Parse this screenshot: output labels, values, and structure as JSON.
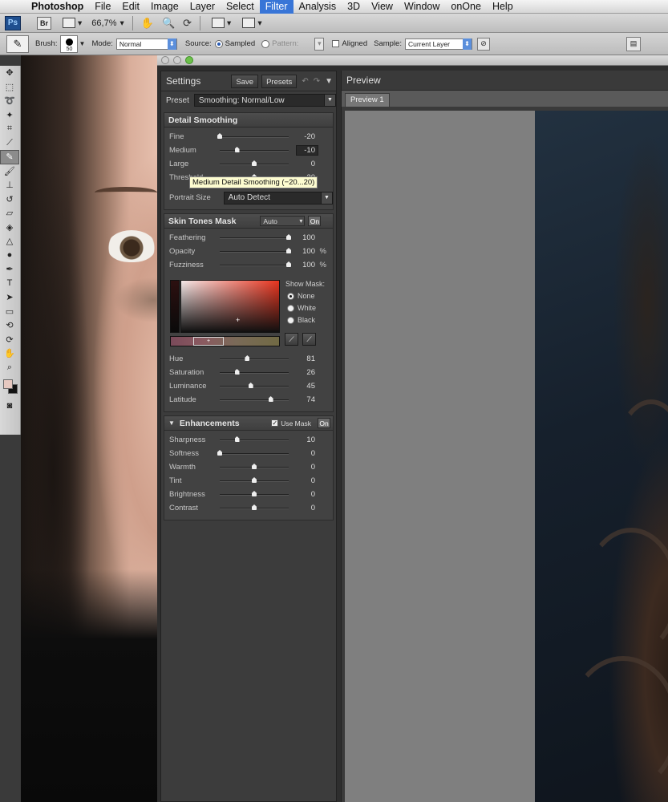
{
  "menubar": {
    "app": "Photoshop",
    "items": [
      "File",
      "Edit",
      "Image",
      "Layer",
      "Select",
      "Filter",
      "Analysis",
      "3D",
      "View",
      "Window",
      "onOne",
      "Help"
    ],
    "active": "Filter"
  },
  "appbar": {
    "ps_logo": "Ps",
    "br_logo": "Br",
    "zoom": "66,7%"
  },
  "options": {
    "brush_label": "Brush:",
    "brush_size": "50",
    "mode_label": "Mode:",
    "mode_value": "Normal",
    "source_label": "Source:",
    "sampled_label": "Sampled",
    "pattern_label": "Pattern:",
    "aligned_label": "Aligned",
    "sample_label": "Sample:",
    "sample_value": "Current Layer"
  },
  "settings": {
    "title": "Settings",
    "save_label": "Save",
    "presets_label": "Presets",
    "preset_label": "Preset",
    "preset_value": "Smoothing: Normal/Low",
    "tooltip": "Medium Detail Smoothing (−20...20)",
    "detail": {
      "title": "Detail Smoothing",
      "sliders": [
        {
          "label": "Fine",
          "value": "-20",
          "pos": 0.0
        },
        {
          "label": "Medium",
          "value": "-10",
          "pos": 0.25
        },
        {
          "label": "Large",
          "value": "0",
          "pos": 0.5
        },
        {
          "label": "Threshold",
          "value": "20",
          "pos": 0.5
        }
      ],
      "portrait_label": "Portrait Size",
      "portrait_value": "Auto Detect"
    },
    "skin": {
      "title": "Skin Tones Mask",
      "mode_value": "Auto",
      "on_label": "On",
      "sliders": [
        {
          "label": "Feathering",
          "value": "100",
          "unit": "",
          "pos": 1.0
        },
        {
          "label": "Opacity",
          "value": "100",
          "unit": "%",
          "pos": 1.0
        },
        {
          "label": "Fuzziness",
          "value": "100",
          "unit": "%",
          "pos": 1.0
        }
      ],
      "show_mask_label": "Show Mask:",
      "mask_options": [
        "None",
        "White",
        "Black"
      ],
      "mask_selected": "None",
      "hsl": [
        {
          "label": "Hue",
          "value": "81",
          "pos": 0.4
        },
        {
          "label": "Saturation",
          "value": "26",
          "pos": 0.25
        },
        {
          "label": "Luminance",
          "value": "45",
          "pos": 0.45
        },
        {
          "label": "Latitude",
          "value": "74",
          "pos": 0.74
        }
      ]
    },
    "enh": {
      "title": "Enhancements",
      "use_mask_label": "Use Mask",
      "on_label": "On",
      "sliders": [
        {
          "label": "Sharpness",
          "value": "10",
          "pos": 0.25
        },
        {
          "label": "Softness",
          "value": "0",
          "pos": 0.0
        },
        {
          "label": "Warmth",
          "value": "0",
          "pos": 0.5
        },
        {
          "label": "Tint",
          "value": "0",
          "pos": 0.5
        },
        {
          "label": "Brightness",
          "value": "0",
          "pos": 0.5
        },
        {
          "label": "Contrast",
          "value": "0",
          "pos": 0.5
        }
      ]
    }
  },
  "preview": {
    "title": "Preview",
    "tab": "Preview 1"
  },
  "colors": {
    "menu_active": "#3875d7",
    "panel_bg": "#3c3c3c",
    "fg_swatch": "#e6c8c0",
    "bg_swatch": "#111111"
  }
}
